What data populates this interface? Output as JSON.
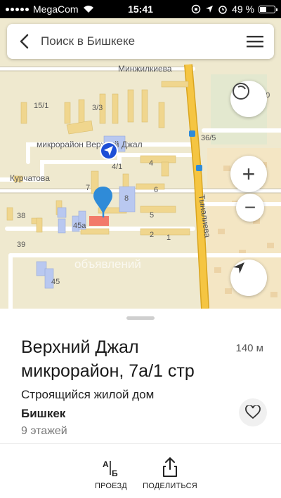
{
  "status_bar": {
    "carrier": "MegaCom",
    "time": "15:41",
    "battery_percent": "49 %",
    "battery_level": 0.49
  },
  "search": {
    "placeholder": "Поиск в Бишкеке",
    "back_icon": "chevron-left-icon",
    "menu_icon": "hamburger-menu-icon"
  },
  "map": {
    "labels": {
      "minzhilkieva": "Минжилкиева",
      "microdistrict": "микрорайон Верхний Джал",
      "kurchatova": "Курчатова",
      "tynalieva": "Тыналиева",
      "watermark": "объявлений"
    },
    "house_numbers": {
      "n15_1": "15/1",
      "n3_3": "3/3",
      "n36_5": "36/5",
      "n4_1": "4/1",
      "n4": "4",
      "n7": "7",
      "n8": "8",
      "n6": "6",
      "n38": "38",
      "n45a": "45а",
      "n39": "39",
      "n2": "2",
      "n1": "1",
      "n45": "45",
      "n60": "60",
      "n5": "5"
    },
    "buttons": {
      "compass_icon": "compass-icon",
      "zoom_in": "+",
      "zoom_out": "−",
      "locate_icon": "navigation-arrow-icon"
    }
  },
  "place": {
    "title": "Верхний Джал микрорайон, 7а/1 стр",
    "distance": "140 м",
    "type": "Строящийся жилой дом",
    "city": "Бишкек",
    "floors": "9 этажей"
  },
  "actions": {
    "route_label": "ПРОЕЗД",
    "share_label": "ПОДЕЛИТЬСЯ"
  },
  "colors": {
    "map_background": "#efe9cf",
    "main_road": "#f5c542",
    "building": "#f0d68e",
    "building_blue": "#b9c8f0",
    "selected_building": "#f27a6a",
    "pin": "#2f8bd8",
    "user_location": "#1e4fd6"
  }
}
